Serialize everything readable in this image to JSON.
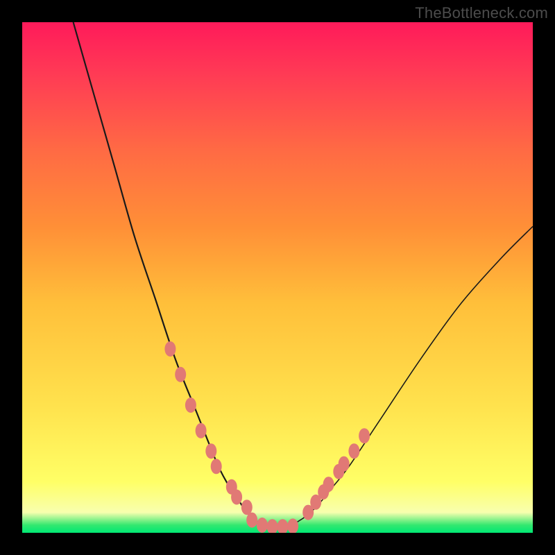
{
  "watermark": "TheBottleneck.com",
  "chart_data": {
    "type": "line",
    "title": "",
    "xlabel": "",
    "ylabel": "",
    "xlim": [
      0,
      100
    ],
    "ylim": [
      0,
      100
    ],
    "background_gradient": {
      "stops": [
        {
          "pos": 0,
          "color": "#00e874"
        },
        {
          "pos": 1.5,
          "color": "#33e86f"
        },
        {
          "pos": 4,
          "color": "#f8ffae"
        },
        {
          "pos": 10,
          "color": "#ffff66"
        },
        {
          "pos": 25,
          "color": "#ffe24d"
        },
        {
          "pos": 45,
          "color": "#ffbf3a"
        },
        {
          "pos": 60,
          "color": "#ff8f37"
        },
        {
          "pos": 75,
          "color": "#ff6a44"
        },
        {
          "pos": 90,
          "color": "#ff3a55"
        },
        {
          "pos": 100,
          "color": "#ff1a5a"
        }
      ]
    },
    "series": [
      {
        "name": "left-branch",
        "x": [
          10,
          14,
          18,
          22,
          26,
          30,
          34,
          38,
          40,
          42,
          44,
          46,
          48,
          50
        ],
        "y": [
          100,
          86,
          72,
          58,
          46,
          34,
          24,
          14,
          10,
          7,
          4,
          2.2,
          1.2,
          1
        ]
      },
      {
        "name": "right-branch",
        "x": [
          50,
          52,
          54,
          56,
          58,
          60,
          64,
          70,
          78,
          86,
          94,
          100
        ],
        "y": [
          1,
          1.3,
          2.2,
          3.6,
          5.5,
          8,
          13,
          22,
          34,
          45,
          54,
          60
        ]
      }
    ],
    "points": [
      {
        "series": "left-branch",
        "x": 29,
        "y": 36
      },
      {
        "series": "left-branch",
        "x": 31,
        "y": 31
      },
      {
        "series": "left-branch",
        "x": 33,
        "y": 25
      },
      {
        "series": "left-branch",
        "x": 35,
        "y": 20
      },
      {
        "series": "left-branch",
        "x": 37,
        "y": 16
      },
      {
        "series": "left-branch",
        "x": 38,
        "y": 13
      },
      {
        "series": "left-branch",
        "x": 41,
        "y": 9
      },
      {
        "series": "left-branch",
        "x": 42,
        "y": 7
      },
      {
        "series": "left-branch",
        "x": 44,
        "y": 5
      },
      {
        "series": "left-branch",
        "x": 45,
        "y": 2.5
      },
      {
        "series": "left-branch",
        "x": 47,
        "y": 1.5
      },
      {
        "series": "left-branch",
        "x": 49,
        "y": 1.2
      },
      {
        "series": "left-branch",
        "x": 51,
        "y": 1.2
      },
      {
        "series": "left-branch",
        "x": 53,
        "y": 1.3
      },
      {
        "series": "right-branch",
        "x": 56,
        "y": 4
      },
      {
        "series": "right-branch",
        "x": 57.5,
        "y": 6
      },
      {
        "series": "right-branch",
        "x": 59,
        "y": 8
      },
      {
        "series": "right-branch",
        "x": 60,
        "y": 9.5
      },
      {
        "series": "right-branch",
        "x": 62,
        "y": 12
      },
      {
        "series": "right-branch",
        "x": 63,
        "y": 13.5
      },
      {
        "series": "right-branch",
        "x": 65,
        "y": 16
      },
      {
        "series": "right-branch",
        "x": 67,
        "y": 19
      }
    ]
  }
}
